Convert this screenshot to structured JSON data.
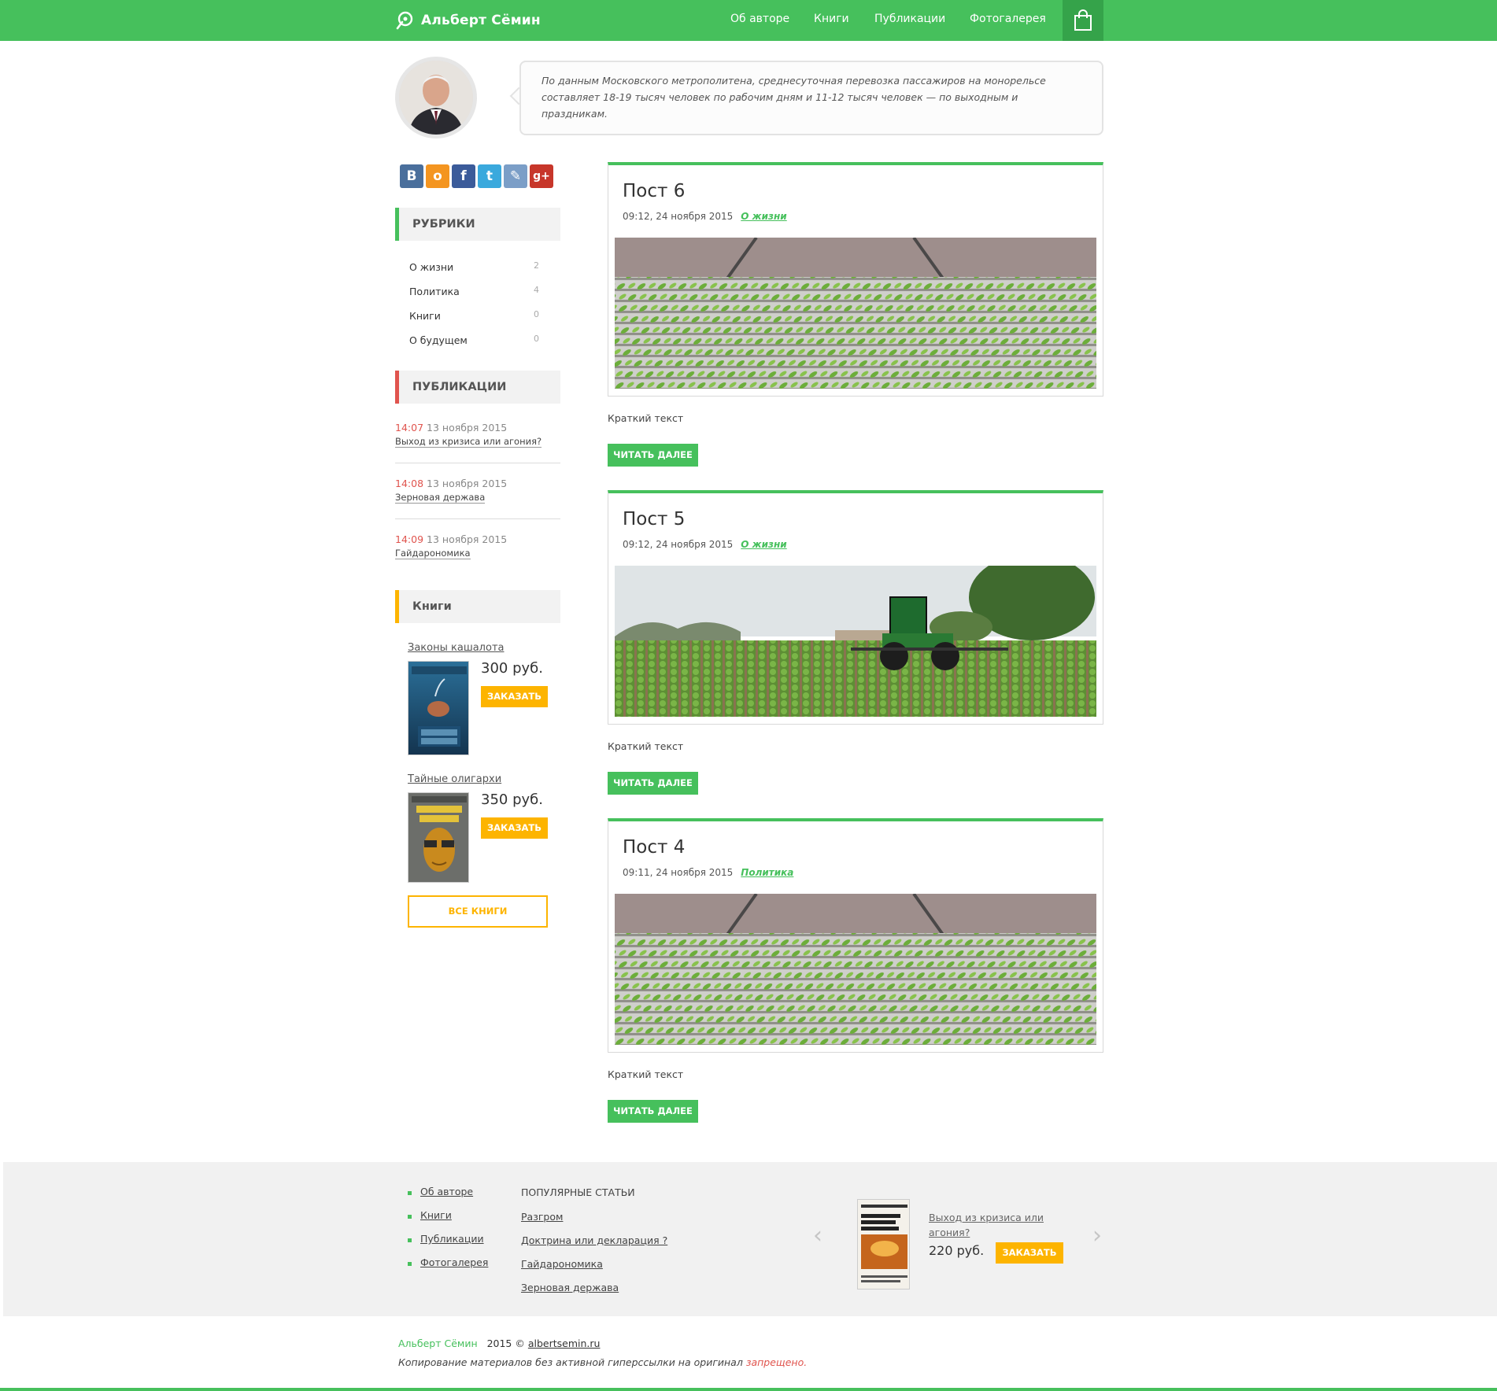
{
  "header": {
    "logo_text": "Альберт Сёмин",
    "nav": [
      "Об авторе",
      "Книги",
      "Публикации",
      "Фотогалерея"
    ]
  },
  "quote": {
    "text": "По данным Московского метрополитена, среднесуточная перевозка пассажиров на монорельсе составляет 18-19 тысяч человек по рабочим дням и 11-12 тысяч человек — по выходным и праздникам."
  },
  "social": [
    "В",
    "о",
    "f",
    "t",
    "✎",
    "g+"
  ],
  "rubrics": {
    "title": "РУБРИКИ",
    "items": [
      {
        "label": "О жизни",
        "count": "2"
      },
      {
        "label": "Политика",
        "count": "4"
      },
      {
        "label": "Книги",
        "count": "0"
      },
      {
        "label": "О будущем",
        "count": "0"
      }
    ]
  },
  "publications": {
    "title": "ПУБЛИКАЦИИ",
    "items": [
      {
        "time": "14:07",
        "date": "13 ноября 2015",
        "title": "Выход из кризиса или агония?"
      },
      {
        "time": "14:08",
        "date": "13 ноября 2015",
        "title": "Зерновая держава"
      },
      {
        "time": "14:09",
        "date": "13 ноября 2015",
        "title": "Гайдарономика"
      }
    ]
  },
  "books": {
    "title": "Книги",
    "items": [
      {
        "title": "Законы кашалота",
        "price": "300 руб.",
        "order": "ЗАКАЗАТЬ"
      },
      {
        "title": "Тайные олигархи",
        "price": "350 руб.",
        "order": "ЗАКАЗАТЬ"
      }
    ],
    "all_books": "ВСЕ КНИГИ"
  },
  "posts": [
    {
      "title": "Пост 6",
      "meta": "09:12, 24 ноября 2015",
      "category": "О жизни",
      "short": "Краткий текст",
      "read_more": "ЧИТАТЬ ДАЛЕЕ"
    },
    {
      "title": "Пост 5",
      "meta": "09:12, 24 ноября 2015",
      "category": "О жизни",
      "short": "Краткий текст",
      "read_more": "ЧИТАТЬ ДАЛЕЕ"
    },
    {
      "title": "Пост 4",
      "meta": "09:11, 24 ноября 2015",
      "category": "Политика",
      "short": "Краткий текст",
      "read_more": "ЧИТАТЬ ДАЛЕЕ"
    }
  ],
  "footer": {
    "links": [
      "Об авторе",
      "Книги",
      "Публикации",
      "Фотогалерея"
    ],
    "popular_title": "ПОПУЛЯРНЫЕ СТАТЬИ",
    "popular": [
      "Разгром",
      "Доктрина или декларация ?",
      "Гайдарономика",
      "Зерновая держава"
    ],
    "book_title": "Выход из кризиса или агония?",
    "book_price": "220 руб.",
    "book_order": "ЗАКАЗАТЬ"
  },
  "copyright": {
    "name": "Альберт Сёмин",
    "year": "2015 ©",
    "site": "albertsemin.ru",
    "notice": "Копирование материалов без активной гиперссылки на оригинал",
    "forbidden": "запрещено."
  },
  "colors": {
    "brand_green": "#46c05c",
    "order_yellow": "#fdb400",
    "accent_red": "#e0544e"
  }
}
